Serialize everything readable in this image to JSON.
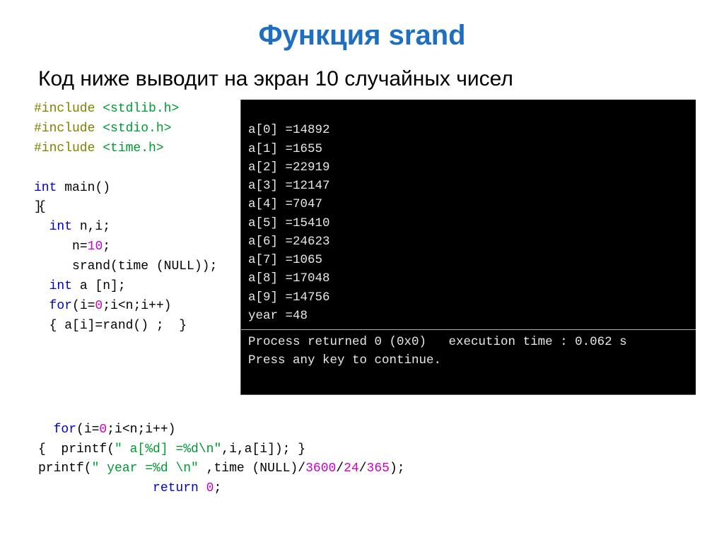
{
  "title": "Функция srand",
  "subtitle": "Код ниже выводит на экран 10 случайных чисел",
  "code": {
    "inc1_kw": "#include ",
    "inc1_arg": "<stdlib.h>",
    "inc2_kw": "#include ",
    "inc2_arg": "<stdio.h>",
    "inc3_kw": "#include ",
    "inc3_arg": "<time.h>",
    "main_kw": "int ",
    "main_name": "main",
    "main_paren": "()",
    "brace_open_marker": "]",
    "brace_open": "{",
    "decl_kw": "int ",
    "decl_rest": "n,i;",
    "assign_n": "n=",
    "assign_n_num_a": "1",
    "assign_n_num_b": "0",
    "assign_n_semi": ";",
    "srand_call": "srand(time (NULL));",
    "arr_kw": "int ",
    "arr_rest": "a [n];",
    "for1_kw_a": "for",
    "for1_p1": "(i=",
    "for1_zero": "0",
    "for1_p2": ";i<n;i++)",
    "for1_body": "{ a[i]=rand() ;  }",
    "for2_kw": "for",
    "for2_p1": "(i=",
    "for2_zero": "0",
    "for2_p2": ";i<n;i++)",
    "printf1_open": "{  printf(",
    "printf1_fmt": "\" a[%d] =%d\\n\"",
    "printf1_rest": ",i,a[i]); }",
    "printf2_open": "printf(",
    "printf2_fmt": "\" year =%d \\n\"",
    "printf2_rest": " ,time (NULL)/",
    "printf2_n1": "3600",
    "printf2_slash1": "/",
    "printf2_n2": "24",
    "printf2_slash2": "/",
    "printf2_n3": "365",
    "printf2_end": ");",
    "return_kw": "return ",
    "return_num": "0",
    "return_semi": ";"
  },
  "console": {
    "lines": [
      "a[0] =14892",
      "a[1] =1655",
      "a[2] =22919",
      "a[3] =12147",
      "a[4] =7047",
      "a[5] =15410",
      "a[6] =24623",
      "a[7] =1065",
      "a[8] =17048",
      "a[9] =14756",
      "year =48"
    ],
    "status": "Process returned 0 (0x0)   execution time : 0.062 s",
    "prompt": "Press any key to continue."
  }
}
